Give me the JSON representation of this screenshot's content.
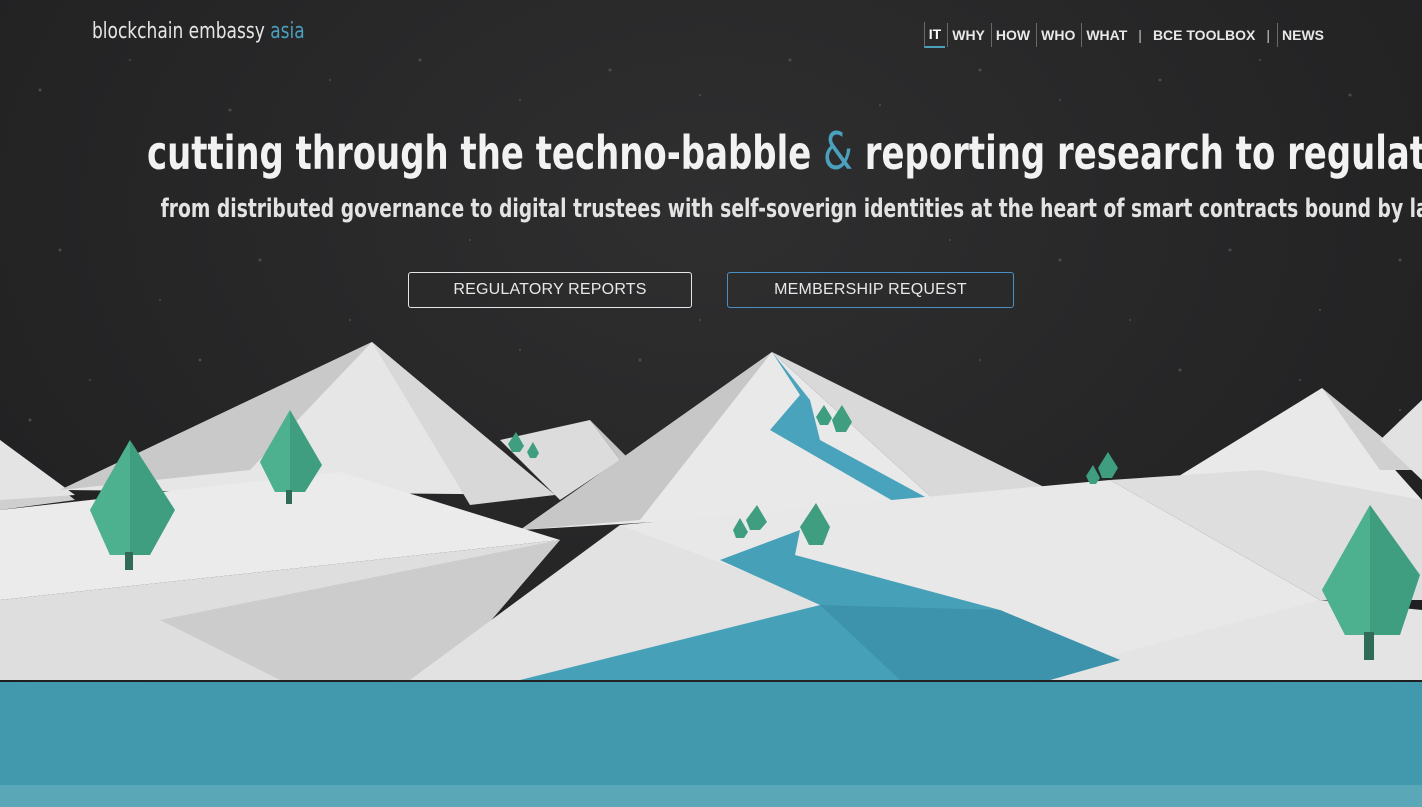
{
  "header": {
    "logo_main": "blockchain embassy",
    "logo_accent": "asia",
    "nav": [
      {
        "label": "IT",
        "active": true
      },
      {
        "label": "WHY"
      },
      {
        "label": "HOW"
      },
      {
        "label": "WHO"
      },
      {
        "label": "WHAT"
      },
      {
        "label": "BCE TOOLBOX"
      },
      {
        "label": "NEWS"
      }
    ],
    "nav_separator": "|"
  },
  "hero": {
    "headline_part1": "cutting through the techno-babble",
    "headline_amp": "&",
    "headline_part2": "reporting research to regulators",
    "subline": "from distributed governance to digital trustees with self-soverign identities at the heart of smart contracts bound by law",
    "buttons": {
      "reports_label": "REGULATORY REPORTS",
      "membership_label": "MEMBERSHIP REQUEST"
    }
  },
  "colors": {
    "accent": "#4aa0bd",
    "background": "#262627",
    "lake": "#4298ad",
    "tree": "#3f9e7f"
  },
  "icons": [
    "tree-icon",
    "mountain-illustration",
    "river-illustration"
  ]
}
